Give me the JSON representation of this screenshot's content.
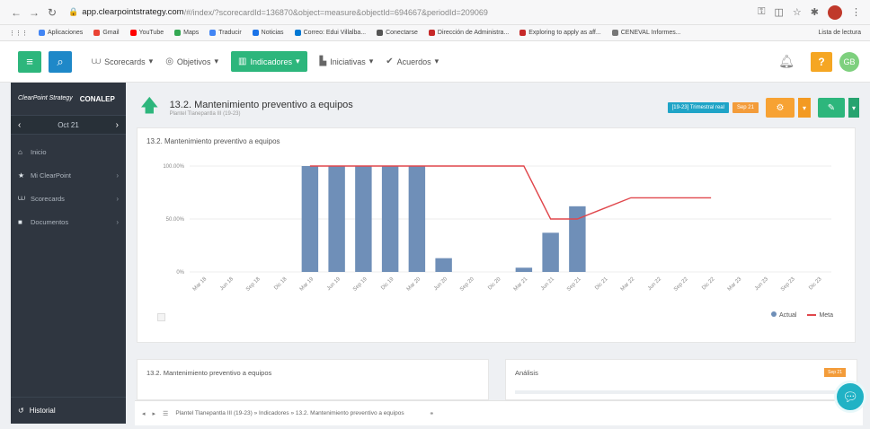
{
  "browser": {
    "url_host": "app.clearpointstrategy.com",
    "url_path": "/#/index/?scorecardId=136870&object=measure&objectId=694667&periodId=209069",
    "bookmarks": [
      {
        "label": "Aplicaciones",
        "color": "#4285f4"
      },
      {
        "label": "Gmail",
        "color": "#ea4335"
      },
      {
        "label": "YouTube",
        "color": "#ff0000"
      },
      {
        "label": "Maps",
        "color": "#34a853"
      },
      {
        "label": "Traducir",
        "color": "#4285f4"
      },
      {
        "label": "Noticias",
        "color": "#1a73e8"
      },
      {
        "label": "Correo: Edui Villalba...",
        "color": "#0078d4"
      },
      {
        "label": "Conectarse",
        "color": "#555555"
      },
      {
        "label": "Dirección de Administra...",
        "color": "#c62828"
      },
      {
        "label": "Exploring to apply as aff...",
        "color": "#c62828"
      },
      {
        "label": "CENEVAL Informes...",
        "color": "#777777"
      }
    ],
    "bookmarks_right": "Lista de lectura"
  },
  "toolbar": {
    "scorecards": "Scorecards",
    "objetivos": "Objetivos",
    "indicadores": "Indicadores",
    "iniciativas": "Iniciativas",
    "acuerdos": "Acuerdos",
    "help": "?",
    "user_initials": "GB"
  },
  "sidebar": {
    "brand": "ClearPoint Strategy",
    "org": "CONALEP",
    "period": "Oct 21",
    "items": [
      {
        "label": "Inicio"
      },
      {
        "label": "Mi ClearPoint"
      },
      {
        "label": "Scorecards"
      },
      {
        "label": "Documentos"
      }
    ],
    "footer": "Historial"
  },
  "header": {
    "title": "13.2. Mantenimiento preventivo a equipos",
    "subtitle": "Plantel Tlanepantla III (19-23)",
    "badge_type": "[19-23] Trimestral real",
    "badge_period": "Sep 21"
  },
  "chart_card": {
    "title": "13.2. Mantenimiento preventivo a equipos"
  },
  "chart_data": {
    "type": "bar",
    "categories": [
      "Mar 18",
      "Jun 18",
      "Sep 18",
      "Dic 18",
      "Mar 19",
      "Jun 19",
      "Sep 19",
      "Dic 19",
      "Mar 20",
      "Jun 20",
      "Sep 20",
      "Dic 20",
      "Mar 21",
      "Jun 21",
      "Sep 21",
      "Dic 21",
      "Mar 22",
      "Jun 22",
      "Sep 22",
      "Dic 22",
      "Mar 23",
      "Jun 23",
      "Sep 23",
      "Dic 23"
    ],
    "series": [
      {
        "name": "Actual",
        "kind": "bar",
        "color": "#6f8fb8",
        "values": [
          null,
          null,
          null,
          null,
          100,
          100,
          100,
          100,
          100,
          13,
          null,
          null,
          4,
          37,
          62,
          null,
          null,
          null,
          null,
          null,
          null,
          null,
          null,
          null
        ]
      },
      {
        "name": "Meta",
        "kind": "line",
        "color": "#e0474c",
        "values": [
          null,
          null,
          null,
          null,
          100,
          100,
          100,
          100,
          100,
          100,
          100,
          100,
          100,
          50,
          50,
          60,
          70,
          70,
          70,
          70,
          null,
          null,
          null,
          null
        ]
      }
    ],
    "yticks": [
      "0%",
      "50.00%",
      "100.00%"
    ],
    "ylim": [
      0,
      100
    ],
    "legend_position": "bottom-right"
  },
  "legend": {
    "actual": "Actual",
    "meta": "Meta"
  },
  "details_card": {
    "title": "13.2. Mantenimiento preventivo a equipos"
  },
  "analysis_card": {
    "title": "Análisis",
    "badge": "Sep 21"
  },
  "bottom_bar": {
    "breadcrumb": "Plantel Tlanepantla III (19-23) » Indicadores » 13.2. Mantenimiento preventivo a equipos"
  }
}
